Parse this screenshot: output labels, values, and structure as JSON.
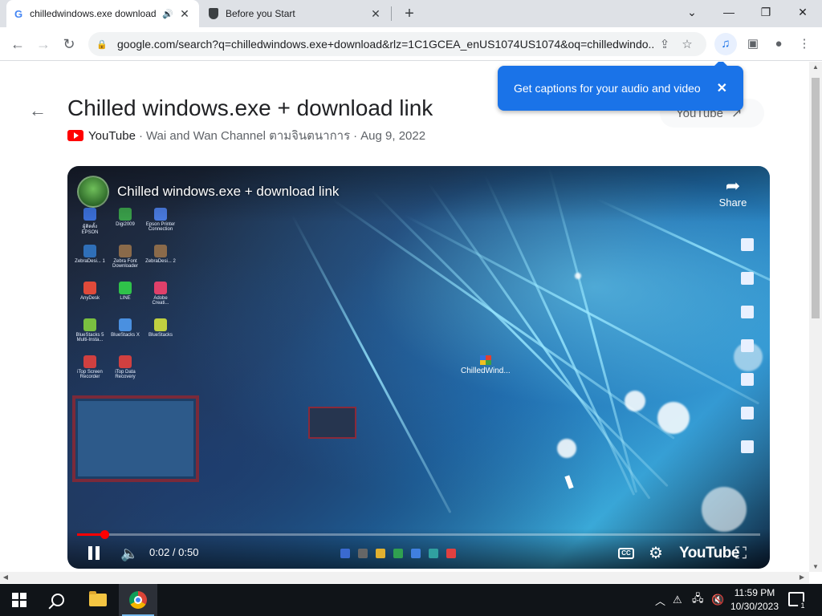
{
  "tabs": [
    {
      "label": "chilledwindows.exe download",
      "favicon": "google-g-icon",
      "speaker": "speaker-icon"
    },
    {
      "label": "Before you Start",
      "favicon": "shield-icon"
    }
  ],
  "toolbar": {
    "url": "google.com/search?q=chilledwindows.exe+download&rlz=1C1GCEA_enUS1074US1074&oq=chilledwindo..."
  },
  "tooltip": {
    "text": "Get captions for your audio and video",
    "close": "✕"
  },
  "page": {
    "title": "Chilled windows.exe + download link",
    "source": "YouTube",
    "channel": "Wai and Wan Channel ตามจินตนาการ",
    "date": "Aug 9, 2022",
    "youtube_link": "YouTube"
  },
  "video": {
    "title": "Chilled windows.exe + download link",
    "share_label": "Share",
    "time": "0:02 / 0:50",
    "progress_fraction": 0.04,
    "brand": "YouTube",
    "cc_label": "CC",
    "center_icon_label": "ChilledWind...",
    "desktop_icons": [
      "ผู้ติดตั้ง EPSON",
      "Digi2009",
      "Epson Printer Connection",
      "ZebraDesi... 1",
      "Zebra Font Downloader",
      "ZebraDesi... 2",
      "AnyDesk",
      "LINE",
      "Adobe Creati...",
      "BlueStacks 5 Multi-Insta...",
      "BlueStacks X",
      "BlueStacks",
      "iTop Screen Recorder",
      "iTop Data Recovery"
    ]
  },
  "taskbar": {
    "time": "11:59 PM",
    "date": "10/30/2023",
    "notification_count": "1"
  },
  "colors": {
    "accent": "#1a73e8",
    "youtube_red": "#ff0000",
    "taskbar": "#101418"
  }
}
